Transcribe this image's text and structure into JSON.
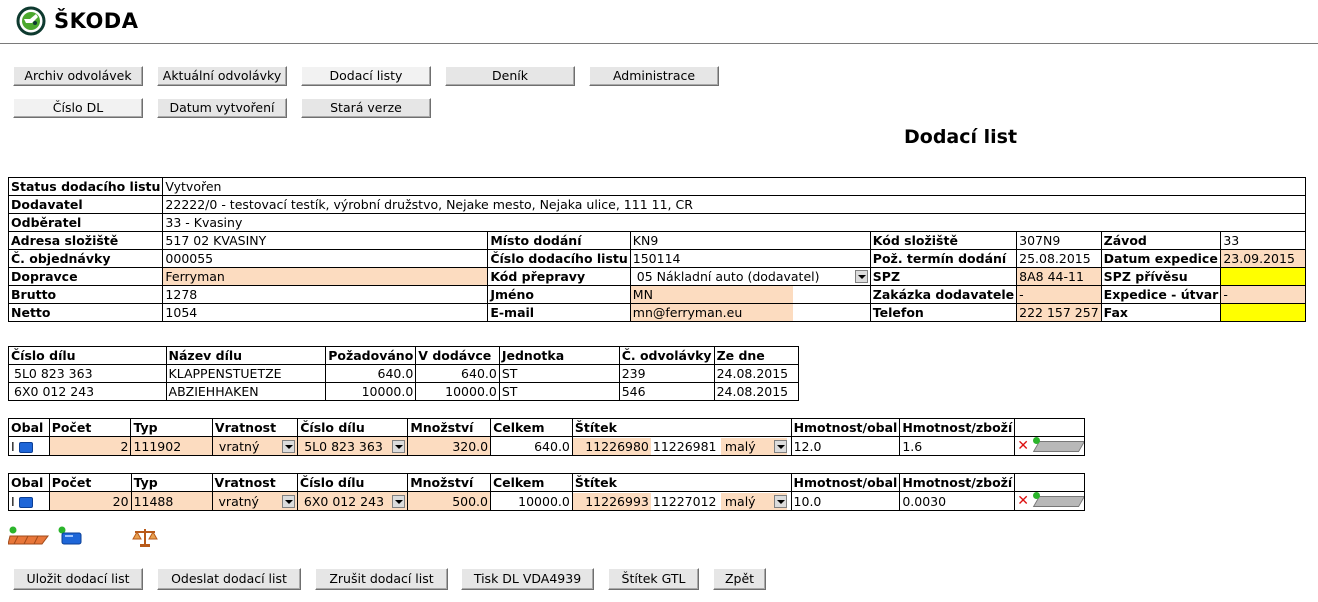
{
  "brand": "ŠKODA",
  "colors": {
    "peach": "#fcdcc0",
    "yellow": "#ffff00",
    "button": "#e6e6e6",
    "delete": "#dd1111",
    "pallet": "#e8763a",
    "box": "#1e66d8"
  },
  "nav": {
    "archiv": "Archiv odvolávek",
    "aktualni": "Aktuální odvolávky",
    "dodaci": "Dodací listy",
    "denik": "Deník",
    "admin": "Administrace",
    "cislo_dl": "Číslo DL",
    "datum": "Datum vytvoření",
    "stara": "Stará verze"
  },
  "page_title": "Dodací list",
  "header": {
    "status_label": "Status dodacího listu",
    "status": "Vytvořen",
    "dodavatel_label": "Dodavatel",
    "dodavatel": "22222/0  -  testovací testík, výrobní družstvo,   Nejake mesto,   Nejaka ulice,   111 11,   CR",
    "odberatel_label": "Odběratel",
    "odberatel": "33 - Kvasiny",
    "adresa_label": "Adresa složiště",
    "adresa": "517 02 KVASINY",
    "misto_label": "Místo dodání",
    "misto": "KN9",
    "kod_slo_label": "Kód složiště",
    "kod_slo": "307N9",
    "zavod_label": "Závod",
    "zavod": "33",
    "obj_label": "Č. objednávky",
    "obj": "000055",
    "cdl_label": "Číslo dodacího listu",
    "cdl": "150114",
    "poz_label": "Pož. termín dodání",
    "poz": "25.08.2015",
    "exp_label": "Datum expedice",
    "exp": "23.09.2015",
    "doprav_label": "Dopravce",
    "doprav": "Ferryman",
    "kodp_label": "Kód přepravy",
    "kodp": "05 Nákladní auto (dodavatel)",
    "spz_label": "SPZ",
    "spz": "8A8 44-11",
    "spzp_label": "SPZ přívěsu",
    "spzp": "",
    "brutto_label": "Brutto",
    "brutto": "1278",
    "jmeno_label": "Jméno",
    "jmeno": "MN",
    "zak_label": "Zakázka dodavatele",
    "zak": "-",
    "expu_label": "Expedice - útvar",
    "expu": "-",
    "netto_label": "Netto",
    "netto": "1054",
    "email_label": "E-mail",
    "email": "mn@ferryman.eu",
    "tel_label": "Telefon",
    "tel": "222 157 257",
    "fax_label": "Fax",
    "fax": ""
  },
  "parts": {
    "headers": [
      "Číslo dílu",
      "Název dílu",
      "Požadováno",
      "V dodávce",
      "Jednotka",
      "Č. odvolávky",
      "Ze dne"
    ],
    "rows": [
      [
        "5L0 823 363",
        "KLAPPENSTUETZE",
        "640.0",
        "640.0",
        "ST",
        "239",
        "24.08.2015"
      ],
      [
        "6X0 012 243",
        "ABZIEHHAKEN",
        "10000.0",
        "10000.0",
        "ST",
        "546",
        "24.08.2015"
      ]
    ]
  },
  "pack_headers": [
    "Obal",
    "Počet",
    "Typ",
    "Vratnost",
    "Číslo dílu",
    "Množství",
    "Celkem",
    "Štítek",
    "Hmotnost/obal",
    "Hmotnost/zboží"
  ],
  "packs": [
    {
      "obal": "I",
      "pocet": "2",
      "typ": "111902",
      "vratnost": "vratný",
      "dil": "5L0 823 363",
      "mnozstvi": "320.0",
      "celkem": "640.0",
      "stitek1": "11226980",
      "stitek2": "11226981",
      "size": "malý",
      "hm_obal": "12.0",
      "hm_zbozi": "1.6"
    },
    {
      "obal": "I",
      "pocet": "20",
      "typ": "11488",
      "vratnost": "vratný",
      "dil": "6X0 012 243",
      "mnozstvi": "500.0",
      "celkem": "10000.0",
      "stitek1": "11226993",
      "stitek2": "11227012",
      "size": "malý",
      "hm_obal": "10.0",
      "hm_zbozi": "0.0030"
    }
  ],
  "actions": {
    "ulozit": "Uložit dodací list",
    "odeslat": "Odeslat dodací list",
    "zrusit": "Zrušit dodací list",
    "tisk": "Tisk DL VDA4939",
    "stitek": "Štítek GTL",
    "zpet": "Zpět"
  }
}
